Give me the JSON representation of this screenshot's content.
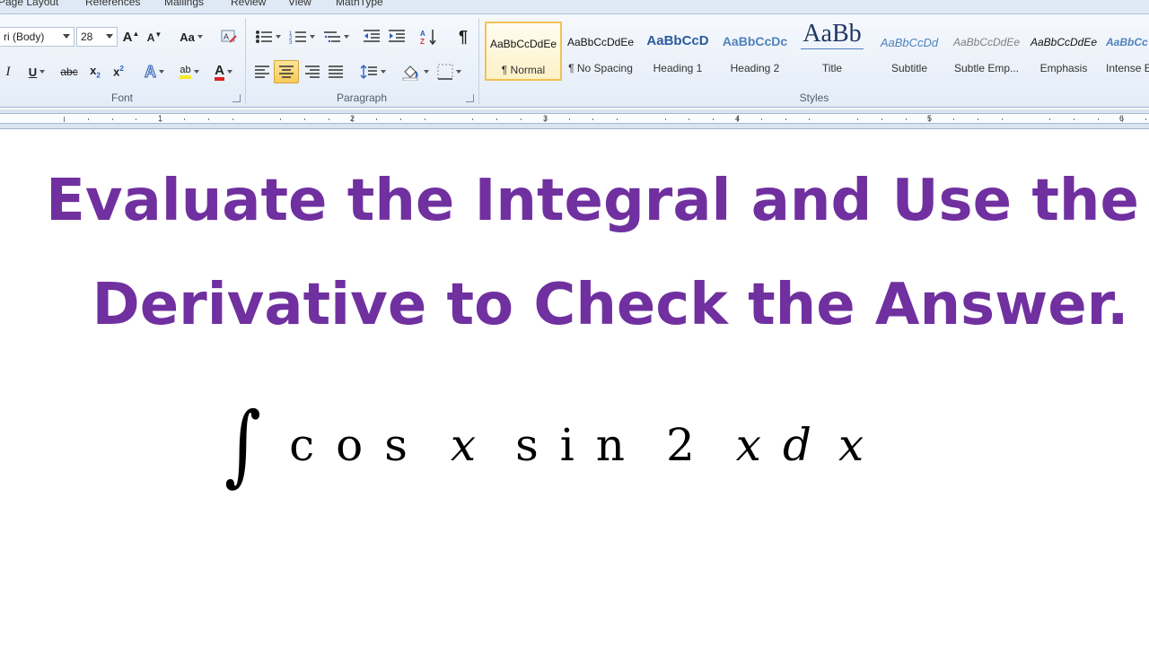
{
  "tabs": [
    "Page Layout",
    "References",
    "Mailings",
    "Review",
    "View",
    "MathType"
  ],
  "font_group": {
    "label": "Font",
    "font_name": "ri (Body)",
    "font_size": "28"
  },
  "paragraph_group": {
    "label": "Paragraph"
  },
  "styles_group": {
    "label": "Styles",
    "items": [
      {
        "sample": "AaBbCcDdEe",
        "name": "¶ Normal"
      },
      {
        "sample": "AaBbCcDdEe",
        "name": "¶ No Spacing"
      },
      {
        "sample": "AaBbCcD",
        "name": "Heading 1"
      },
      {
        "sample": "AaBbCcDc",
        "name": "Heading 2"
      },
      {
        "sample": "AaBb",
        "name": "Title"
      },
      {
        "sample": "AaBbCcDd",
        "name": "Subtitle"
      },
      {
        "sample": "AaBbCcDdEe",
        "name": "Subtle Emp..."
      },
      {
        "sample": "AaBbCcDdEe",
        "name": "Emphasis"
      },
      {
        "sample": "AaBbCc",
        "name": "Intense E"
      }
    ]
  },
  "ruler": {
    "numbers": [
      "1",
      "2",
      "3",
      "4",
      "5",
      "6"
    ]
  },
  "document": {
    "heading_line1": "Evaluate the Integral and Use the",
    "heading_line2": "Derivative to Check the Answer.",
    "heading_color": "#7030a0",
    "formula": [
      "∫",
      "c",
      "o",
      "s",
      "x",
      "s",
      "i",
      "n",
      "2",
      "x",
      "d",
      "x"
    ]
  }
}
